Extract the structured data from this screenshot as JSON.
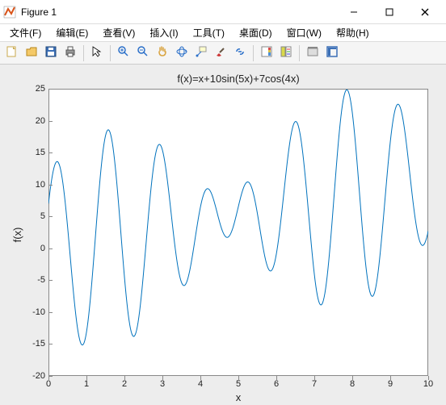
{
  "window": {
    "title": "Figure 1",
    "min_label": "minimize",
    "max_label": "maximize",
    "close_label": "close"
  },
  "menubar": {
    "items": [
      {
        "label": "文件(F)"
      },
      {
        "label": "编辑(E)"
      },
      {
        "label": "查看(V)"
      },
      {
        "label": "插入(I)"
      },
      {
        "label": "工具(T)"
      },
      {
        "label": "桌面(D)"
      },
      {
        "label": "窗口(W)"
      },
      {
        "label": "帮助(H)"
      }
    ]
  },
  "toolbar": {
    "groups": [
      [
        "new-figure",
        "open-file",
        "save",
        "print"
      ],
      [
        "edit-plot"
      ],
      [
        "zoom-in",
        "zoom-out",
        "pan",
        "rotate-3d",
        "data-cursor",
        "brush",
        "link"
      ],
      [
        "insert-colorbar",
        "insert-legend"
      ],
      [
        "hide-tools",
        "show-tools"
      ]
    ]
  },
  "chart_data": {
    "type": "line",
    "title": "f(x)=x+10sin(5x)+7cos(4x)",
    "xlabel": "x",
    "ylabel": "f(x)",
    "xlim": [
      0,
      10
    ],
    "ylim": [
      -20,
      25
    ],
    "xticks": [
      0,
      1,
      2,
      3,
      4,
      5,
      6,
      7,
      8,
      9,
      10
    ],
    "yticks": [
      -20,
      -15,
      -10,
      -5,
      0,
      5,
      10,
      15,
      20,
      25
    ],
    "grid": false,
    "legend": null,
    "formula": "x + 10*sin(5*x) + 7*cos(4*x)",
    "n_samples": 500,
    "series": [
      {
        "name": "f(x)",
        "color": "#0072BD"
      }
    ],
    "sampled_points": [
      {
        "x": 0.0,
        "y": 7.0
      },
      {
        "x": 0.5,
        "y": 3.58
      },
      {
        "x": 1.0,
        "y": -13.17
      },
      {
        "x": 1.5,
        "y": 18.16
      },
      {
        "x": 2.0,
        "y": -4.46
      },
      {
        "x": 2.5,
        "y": -4.04
      },
      {
        "x": 3.0,
        "y": 15.41
      },
      {
        "x": 3.5,
        "y": -3.47
      },
      {
        "x": 4.0,
        "y": 10.95
      },
      {
        "x": 4.5,
        "y": 1.57
      },
      {
        "x": 5.0,
        "y": 9.53
      },
      {
        "x": 5.5,
        "y": -1.46
      },
      {
        "x": 6.0,
        "y": -3.05
      },
      {
        "x": 6.5,
        "y": 19.97
      },
      {
        "x": 7.0,
        "y": 4.69
      },
      {
        "x": 7.5,
        "y": -4.42
      },
      {
        "x": 8.0,
        "y": 22.97
      },
      {
        "x": 8.5,
        "y": -2.54
      },
      {
        "x": 9.0,
        "y": 10.61
      },
      {
        "x": 9.5,
        "y": 13.33
      },
      {
        "x": 10.0,
        "y": 2.15
      }
    ]
  }
}
